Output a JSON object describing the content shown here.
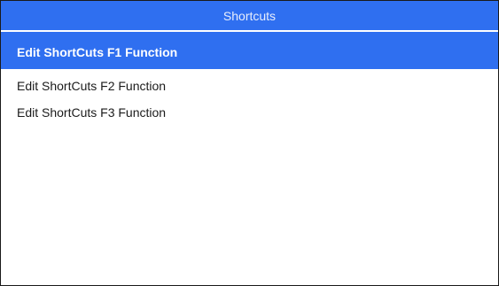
{
  "window": {
    "title": "Shortcuts"
  },
  "menu": {
    "items": [
      {
        "label": "Edit ShortCuts F1 Function",
        "selected": true
      },
      {
        "label": "Edit ShortCuts F2 Function",
        "selected": false
      },
      {
        "label": "Edit ShortCuts F3 Function",
        "selected": false
      }
    ]
  },
  "colors": {
    "accent": "#2f6ff0",
    "border": "#1a1a1a",
    "background": "#ffffff"
  }
}
